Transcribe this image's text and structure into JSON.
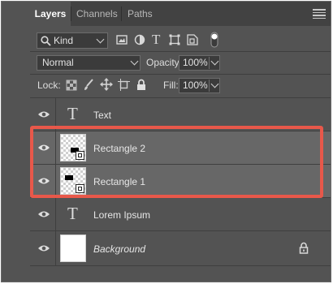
{
  "tabs": [
    {
      "label": "Layers",
      "active": true
    },
    {
      "label": "Channels",
      "active": false
    },
    {
      "label": "Paths",
      "active": false
    }
  ],
  "filter": {
    "kind_label": "Kind",
    "icons": [
      "image-filter-icon",
      "adjustment-filter-icon",
      "type-filter-icon",
      "shape-filter-icon",
      "smart-object-filter-icon",
      "filter-toggle-icon"
    ]
  },
  "blend": {
    "mode": "Normal",
    "opacity_label": "Opacity:",
    "opacity_value": "100%"
  },
  "lock": {
    "label": "Lock:",
    "fill_label": "Fill:",
    "fill_value": "100%",
    "icons": [
      "lock-transparent-pixels-icon",
      "lock-image-pixels-icon",
      "lock-position-icon",
      "lock-artboard-icon",
      "lock-all-icon"
    ]
  },
  "layers": [
    {
      "name": "Text",
      "type": "text",
      "selected": false
    },
    {
      "name": "Rectangle 2",
      "type": "smart-object",
      "selected": true
    },
    {
      "name": "Rectangle 1",
      "type": "smart-object",
      "selected": true
    },
    {
      "name": "Lorem Ipsum",
      "type": "text",
      "selected": false
    },
    {
      "name": "Background",
      "type": "background",
      "selected": false,
      "locked": true
    }
  ],
  "colors": {
    "panel_bg": "#535353",
    "tab_bg": "#424242",
    "selected_row": "#676767",
    "highlight_border": "#e8584a"
  }
}
